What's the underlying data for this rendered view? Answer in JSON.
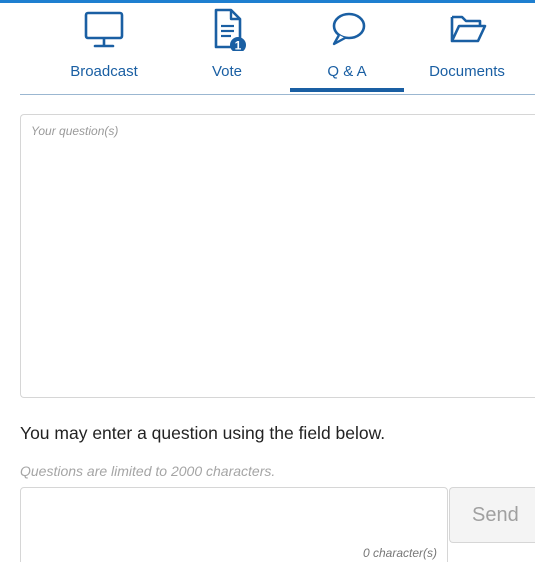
{
  "tabs": [
    {
      "label": "Broadcast",
      "icon": "monitor-icon"
    },
    {
      "label": "Vote",
      "icon": "document-icon",
      "badge": "1"
    },
    {
      "label": "Q & A",
      "icon": "chat-bubble-icon",
      "active": true
    },
    {
      "label": "Documents",
      "icon": "folder-icon"
    }
  ],
  "question_box": {
    "placeholder": "Your question(s)",
    "value": ""
  },
  "instructions": "You may enter a question using the field below.",
  "limit_note": "Questions are limited to 2000  characters.",
  "question_field": {
    "value": "",
    "char_count": "0 character(s)"
  },
  "send_label": "Send",
  "colors": {
    "accent": "#1a5fa3",
    "top_strip": "#1e7fd0",
    "badge": "#1a5fa3"
  }
}
